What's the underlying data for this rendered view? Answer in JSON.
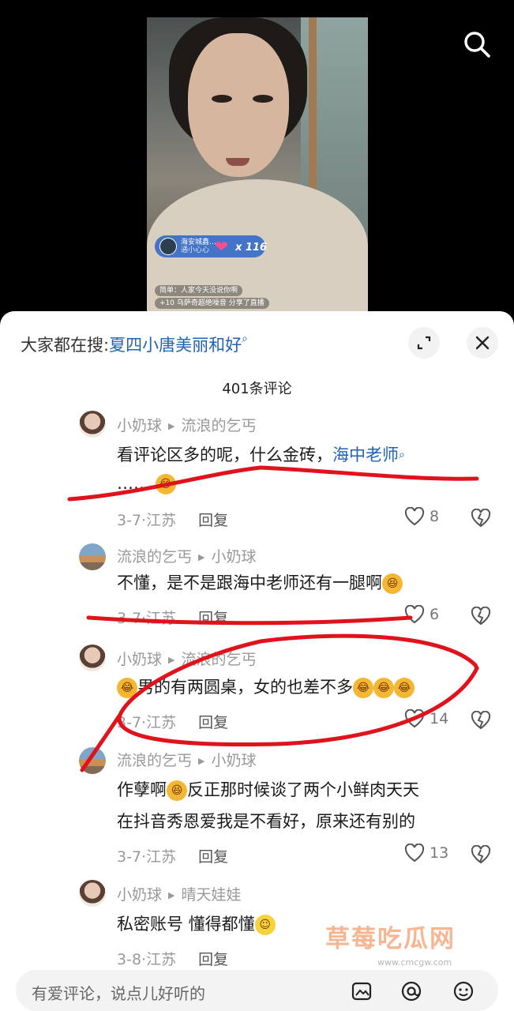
{
  "video": {
    "streamer_name": "海安城鑫…",
    "streamer_sub": "通小心心",
    "gift_count": "x 116",
    "chat_line_1": "简单：人家今天没说你啊",
    "chat_line_2": "+10 乌萨奇超绝噪音 分享了直播"
  },
  "hot_search": {
    "prefix": "大家都在搜:",
    "keyword": "夏四小唐美丽和好",
    "search_glyph": "⌕"
  },
  "comments_title": "401条评论",
  "comments": [
    {
      "user": "小奶球",
      "reply_to": "流浪的乞丐",
      "text": "看评论区多的呢，什么金砖，",
      "link_text": "海中老师",
      "text_line2": "……",
      "date_loc": "3-7·江苏",
      "reply_label": "回复",
      "likes": "8"
    },
    {
      "user": "流浪的乞丐",
      "reply_to": "小奶球",
      "text": "不懂，是不是跟海中老师还有一腿啊",
      "date_loc": "3-7·江苏",
      "reply_label": "回复",
      "likes": "6"
    },
    {
      "user": "小奶球",
      "reply_to": "流浪的乞丐",
      "text": "男的有两圆桌，女的也差不多",
      "date_loc": "3-7·江苏",
      "reply_label": "回复",
      "likes": "14"
    },
    {
      "user": "流浪的乞丐",
      "reply_to": "小奶球",
      "text": "作孽啊",
      "text_cont": "反正那时候谈了两个小鲜肉天天",
      "text_line2": "在抖音秀恩爱我是不看好，原来还有别的",
      "date_loc": "3-7·江苏",
      "reply_label": "回复",
      "likes": "13"
    },
    {
      "user": "小奶球",
      "reply_to": "晴天娃娃",
      "text": "私密账号 懂得都懂",
      "date_loc": "3-8·江苏",
      "reply_label": "回复"
    }
  ],
  "watermark": "草莓吃瓜网",
  "watermark_url": "www.cmcgw.com",
  "input": {
    "placeholder": "有爱评论，说点儿好听的"
  },
  "icons": {
    "top_search": "search-icon",
    "expand": "expand-icon",
    "close": "close-icon",
    "like": "heart-outline-icon",
    "dislike": "broken-heart-icon",
    "image": "image-icon",
    "at": "at-icon",
    "emoji": "emoji-icon"
  },
  "colors": {
    "link": "#1f63b8",
    "annotation_red": "#e0121b"
  }
}
